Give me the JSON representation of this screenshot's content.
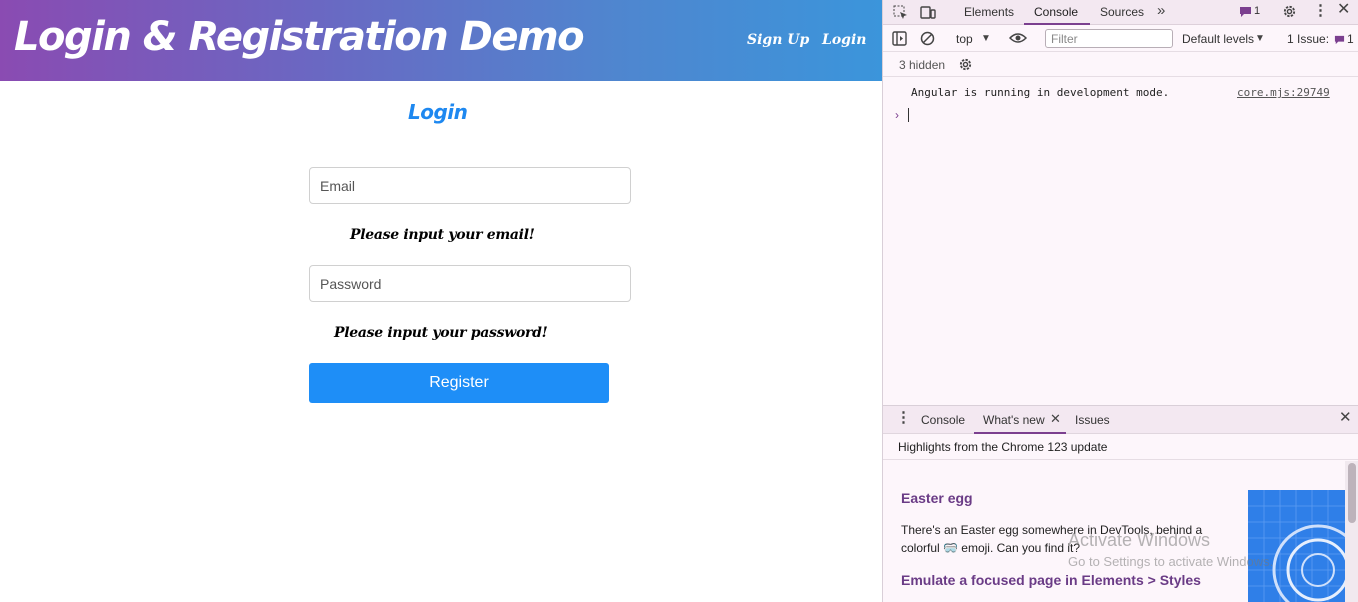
{
  "navbar": {
    "brand": "Login & Registration Demo",
    "signup": "Sign Up",
    "login": "Login"
  },
  "form": {
    "heading": "Login",
    "email_placeholder": "Email",
    "email_error": "Please input your email!",
    "password_placeholder": "Password",
    "password_error": "Please input your password!",
    "submit_label": "Register"
  },
  "devtools": {
    "tabs": [
      "Elements",
      "Console",
      "Sources"
    ],
    "active_tab": "Console",
    "messages_badge": "1",
    "context": "top",
    "filter_placeholder": "Filter",
    "levels": "Default levels",
    "issues_label": "1 Issue:",
    "issues_count": "1",
    "hidden": "3 hidden",
    "console_message": "Angular is running in development mode.",
    "console_source": "core.mjs:29749",
    "drawer_tabs": [
      "Console",
      "What's new",
      "Issues"
    ],
    "drawer_active": "What's new",
    "whatsnew_header": "Highlights from the Chrome 123 update",
    "easter_title": "Easter egg",
    "easter_line1": "There's an Easter egg somewhere in DevTools, behind a",
    "easter_line2": "colorful 🥽 emoji. Can you find it?",
    "emulate_title": "Emulate a focused page in Elements > Styles"
  },
  "watermark": {
    "title": "Activate Windows",
    "subtitle": "Go to Settings to activate Windows."
  },
  "colors": {
    "accent": "#1e8ef7",
    "devtools_accent": "#7b3f8f"
  }
}
